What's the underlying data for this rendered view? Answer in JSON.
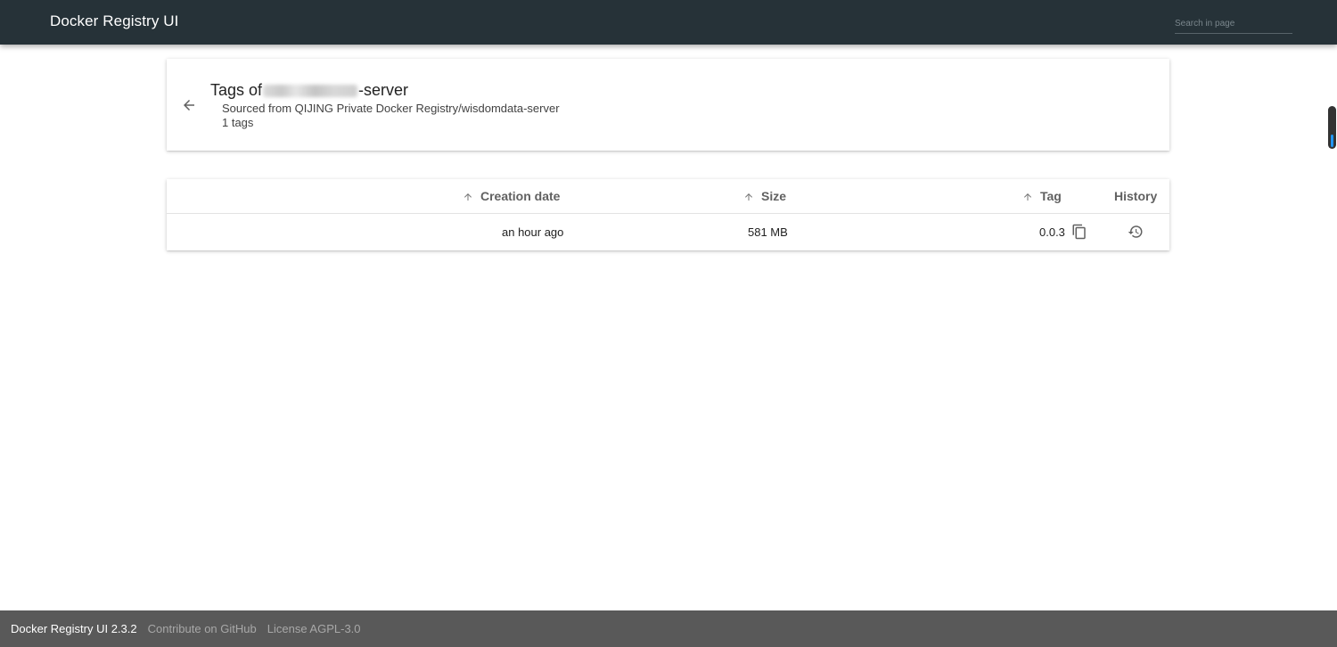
{
  "header": {
    "title": "Docker Registry UI",
    "search_placeholder": "Search in page"
  },
  "title_card": {
    "title_prefix": "Tags of",
    "title_suffix": "-server",
    "subtitle": "Sourced from QIJING Private Docker Registry/wisdomdata-server",
    "tag_count": "1 tags"
  },
  "table": {
    "columns": {
      "creation_date": "Creation date",
      "size": "Size",
      "tag": "Tag",
      "history": "History"
    },
    "rows": [
      {
        "creation_date": "an hour ago",
        "size": "581 MB",
        "tag": "0.0.3"
      }
    ]
  },
  "footer": {
    "version": "Docker Registry UI 2.3.2",
    "github_link": "Contribute on GitHub",
    "license_link": "License AGPL-3.0"
  },
  "colors": {
    "header_bg": "#263238",
    "footer_bg": "#595959",
    "scroll_accent": "#2196f3"
  },
  "icons": [
    "arrow-back-icon",
    "arrow-up-icon",
    "copy-icon",
    "history-icon"
  ]
}
